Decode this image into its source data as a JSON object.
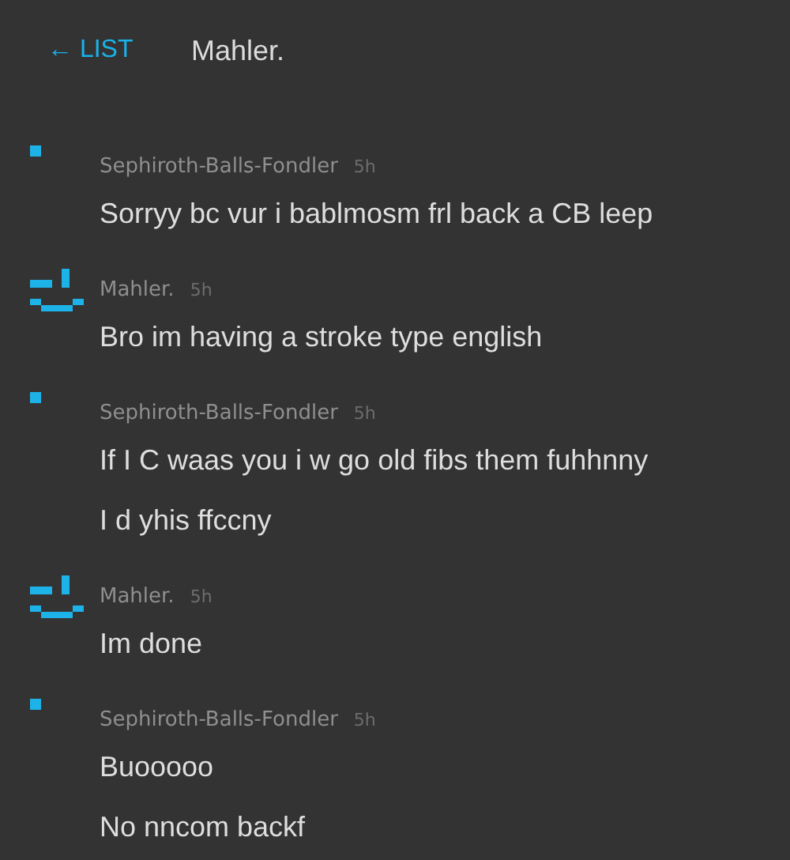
{
  "header": {
    "back_link": "← LIST",
    "title": "Mahler."
  },
  "messages": [
    {
      "avatar": {
        "kind": "dot"
      },
      "author": "Sephiroth-Balls-Fondler",
      "time": "5h",
      "lines": [
        "Sorryy bc vur i bablmosm frl back a CB leep"
      ]
    },
    {
      "avatar": {
        "kind": "face"
      },
      "author": "Mahler.",
      "time": "5h",
      "lines": [
        "Bro im having a stroke type english"
      ]
    },
    {
      "avatar": {
        "kind": "dot"
      },
      "author": "Sephiroth-Balls-Fondler",
      "time": "5h",
      "lines": [
        "If I C waas you i w go old fibs them fuhhnny",
        "I d yhis ffccny"
      ]
    },
    {
      "avatar": {
        "kind": "face"
      },
      "author": "Mahler.",
      "time": "5h",
      "lines": [
        "Im done"
      ]
    },
    {
      "avatar": {
        "kind": "dot"
      },
      "author": "Sephiroth-Balls-Fondler",
      "time": "5h",
      "lines": [
        "Buooooo",
        "No nncom backf"
      ]
    }
  ]
}
